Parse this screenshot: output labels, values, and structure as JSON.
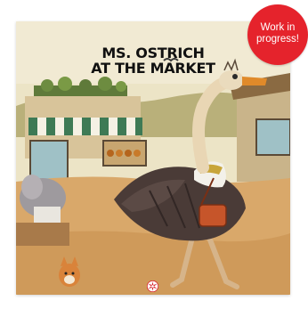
{
  "book": {
    "title_line1": "MS. OSTRICH",
    "title_line2": "AT THE MARKET"
  },
  "badge": {
    "line1": "Work in",
    "line2": "progress!"
  },
  "colors": {
    "badge": "#e5232c",
    "sky": "#efe6c8",
    "ground": "#d9a86a"
  },
  "icons": {
    "publisher_logo": "red-starburst-logo-icon"
  }
}
